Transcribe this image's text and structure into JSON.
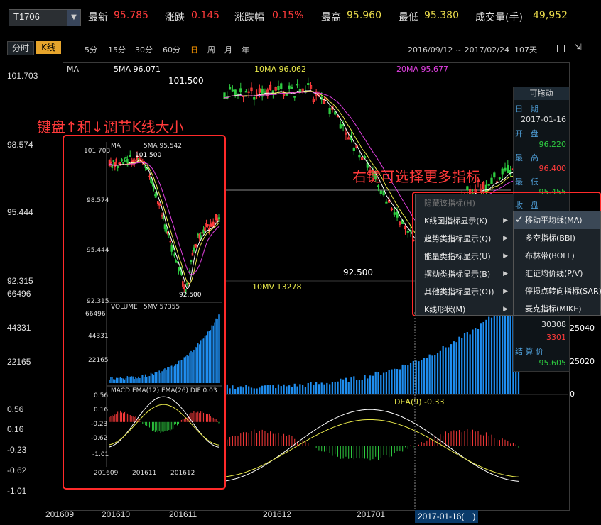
{
  "quote": {
    "symbol": "T1706",
    "latest_label": "最新",
    "latest": "95.785",
    "change_label": "涨跌",
    "change": "0.145",
    "change_pct_label": "涨跌幅",
    "change_pct": "0.15%",
    "high_label": "最高",
    "high": "95.960",
    "low_label": "最低",
    "low": "95.380",
    "volume_label": "成交量(手)",
    "volume": "49,952"
  },
  "toolbar": {
    "timeshare": "分时",
    "kline": "K线",
    "periods": [
      "5分",
      "15分",
      "30分",
      "60分",
      "日",
      "周",
      "月",
      "年"
    ],
    "active_period": "日",
    "range": "2016/09/12 ~ 2017/02/24",
    "days": "107天"
  },
  "main_chart": {
    "y_ticks": [
      "101.703",
      "98.574",
      "95.444",
      "92.315"
    ],
    "legend": {
      "ma": "MA",
      "ma5": "5MA 96.071",
      "ma10": "10MA 96.062",
      "ma20": "20MA 95.677"
    },
    "high_mark": "101.500",
    "low_mark": "92.500"
  },
  "volume_chart": {
    "y_ticks": [
      "66496",
      "44331",
      "22165"
    ],
    "legend": {
      "mv10": "10MV 13278"
    },
    "right_ticks": [
      "25040",
      "25020",
      "0"
    ]
  },
  "macd_chart": {
    "y_ticks": [
      "0.56",
      "0.16",
      "-0.23",
      "-0.62",
      "-1.01"
    ],
    "legend": {
      "dea": "DEA(9) -0.33"
    }
  },
  "x_axis": {
    "labels": [
      "201609",
      "201610",
      "201611",
      "201612",
      "201701"
    ],
    "selected": "2017-01-16(一)"
  },
  "info_panel": {
    "title": "可拖动",
    "date_label": "日　期",
    "date": "2017-01-16",
    "open_label": "开　盘",
    "open": "96.220",
    "high_label": "最　高",
    "high": "96.400",
    "low_label": "最　低",
    "low": "95.455",
    "close_label": "收　盘",
    "v1": "30308",
    "v2": "3301",
    "settle_label": "结 算 价",
    "settle": "95.605"
  },
  "annotations": {
    "left": "键盘↑和↓调节K线大小",
    "right": "右键可选择更多指标"
  },
  "context_menu": {
    "hide": "隐藏该指标(H)",
    "items": [
      "K线图指标显示(K)",
      "趋势类指标显示(Q)",
      "能量类指标显示(U)",
      "摆动类指标显示(B)",
      "其他类指标显示(O))",
      "K线形状(M)"
    ]
  },
  "submenu": {
    "items": [
      "移动平均线(MA)",
      "多空指标(BBI)",
      "布林带(BOLL)",
      "汇证均价线(P/V)",
      "停损点转向指标(SAR)",
      "麦克指标(MIKE)"
    ],
    "checked_index": 0
  },
  "inset": {
    "y_ticks_price": [
      "101.703",
      "98.574",
      "95.444",
      "92.315"
    ],
    "legend_ma": "MA",
    "legend_ma5": "5MA 95.542",
    "high_mark": "101.500",
    "low_mark": "92.500",
    "vol_legend": "VOLUME",
    "vol_ma": "5MV 57355",
    "vol_ticks": [
      "66496",
      "44331",
      "22165"
    ],
    "macd_legend": "MACD",
    "macd_params": "EMA(12) EMA(26) DIF 0.03",
    "macd_ticks": [
      "0.56",
      "0.16",
      "-0.23",
      "-0.62",
      "-1.01"
    ],
    "x_labels": [
      "201609",
      "201611",
      "201612"
    ]
  },
  "colors": {
    "up": "#ff3b3b",
    "down": "#2ecc40",
    "ma5": "#ffffff",
    "ma10": "#e8e84a",
    "ma20": "#e040e0",
    "vol": "#1f8ef0",
    "accent": "#e7a52c",
    "annotation": "#ff2a2a"
  }
}
